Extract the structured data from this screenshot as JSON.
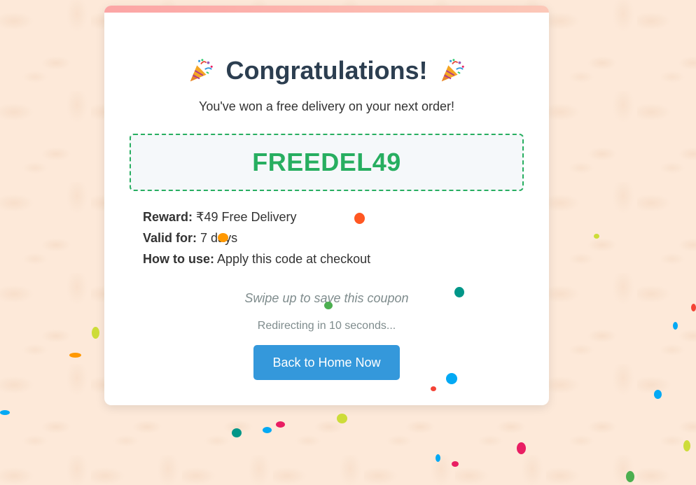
{
  "card": {
    "title": "Congratulations!",
    "subtitle": "You've won a free delivery on your next order!",
    "coupon_code": "FREEDEL49",
    "details": [
      {
        "label": "Reward:",
        "value": "₹49 Free Delivery"
      },
      {
        "label": "Valid for:",
        "value": "7 days"
      },
      {
        "label": "How to use:",
        "value": "Apply this code at checkout"
      }
    ],
    "swipe_hint": "Swipe up to save this coupon",
    "redirect_text": "Redirecting in 10 seconds...",
    "home_button_label": "Back to Home Now"
  },
  "icons": {
    "title_left": "party-popper-icon",
    "title_right": "party-popper-icon"
  },
  "colors": {
    "background": "#fde9d9",
    "accent_bar": "#fca5a5",
    "title": "#2c3e50",
    "coupon": "#27ae60",
    "button": "#3498db",
    "muted": "#7f8c8d"
  }
}
